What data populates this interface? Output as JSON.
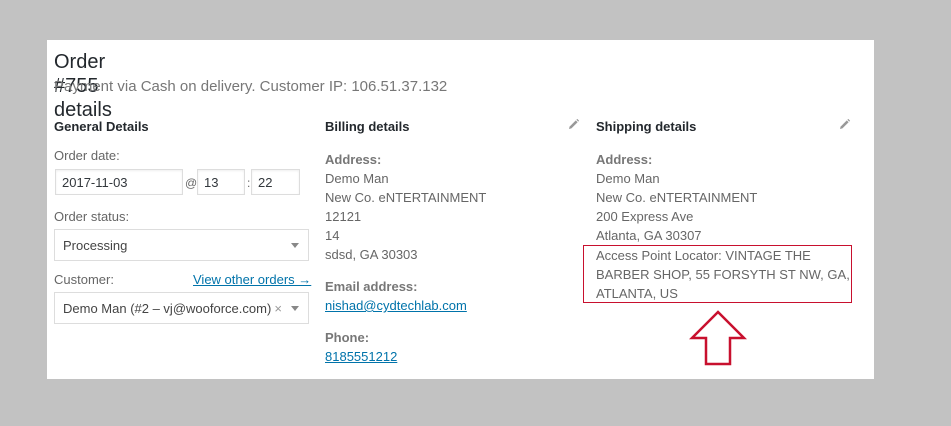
{
  "order": {
    "title": "Order #755 details",
    "subtitle": "Payment via Cash on delivery. Customer IP: 106.51.37.132"
  },
  "general": {
    "heading": "General Details",
    "order_date_label": "Order date:",
    "date_value": "2017-11-03",
    "at_symbol": "@",
    "hour_value": "13",
    "time_colon": ":",
    "minute_value": "22",
    "status_label": "Order status:",
    "status_value": "Processing",
    "customer_label": "Customer:",
    "view_other_orders": "View other orders →",
    "customer_value": "Demo Man (#2 – vj@wooforce.com)",
    "clear_symbol": "×"
  },
  "billing": {
    "heading": "Billing details",
    "address_label": "Address:",
    "address_lines": [
      "Demo Man",
      "New Co. eNTERTAINMENT",
      "12121",
      "14",
      "sdsd, GA 30303"
    ],
    "email_label": "Email address:",
    "email": "nishad@cydtechlab.com",
    "phone_label": "Phone:",
    "phone": "8185551212"
  },
  "shipping": {
    "heading": "Shipping details",
    "address_label": "Address:",
    "address_lines": [
      "Demo Man",
      "New Co. eNTERTAINMENT",
      "200 Express Ave",
      "Atlanta, GA 30307"
    ],
    "locator_text": "Access Point Locator: VINTAGE THE BARBER SHOP, 55 FORSYTH ST NW, GA, ATLANTA, US"
  },
  "icons": {
    "edit": "pencil-icon",
    "annotation": "up-arrow-icon",
    "annotation_color": "#c8102e"
  }
}
